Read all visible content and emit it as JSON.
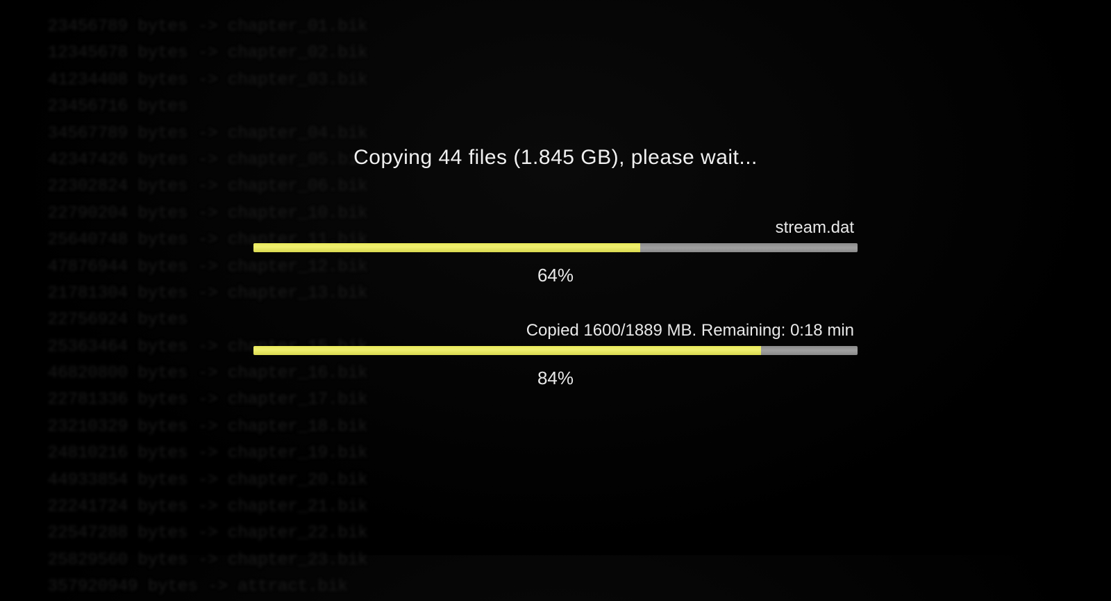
{
  "dialog": {
    "title": "Copying 44 files (1.845 GB), please wait...",
    "file_progress": {
      "label": "stream.dat",
      "percent": 64,
      "percent_text": "64%"
    },
    "total_progress": {
      "label": "Copied 1600/1889 MB. Remaining: 0:18 min",
      "percent": 84,
      "percent_text": "84%"
    }
  },
  "background_log": "  23456789 bytes -> chapter_01.bik\n  12345678 bytes -> chapter_02.bik\n  41234408 bytes -> chapter_03.bik\n  23456716 bytes\n  34567789 bytes -> chapter_04.bik\n  42347426 bytes -> chapter_05.bik\n  22302824 bytes -> chapter_06.bik\n  22790204 bytes -> chapter_10.bik\n  25640748 bytes -> chapter_11.bik\n  47876944 bytes -> chapter_12.bik\n  21781304 bytes -> chapter_13.bik\n  22756924 bytes\n  25363464 bytes -> chapter_15.bik\n  46820800 bytes -> chapter_16.bik\n  22781336 bytes -> chapter_17.bik\n  23210329 bytes -> chapter_18.bik\n  24810216 bytes -> chapter_19.bik\n  44933854 bytes -> chapter_20.bik\n  22241724 bytes -> chapter_21.bik\n  22547288 bytes -> chapter_22.bik\n  25829560 bytes -> chapter_23.bik\n  357920949 bytes -> attract.bik"
}
